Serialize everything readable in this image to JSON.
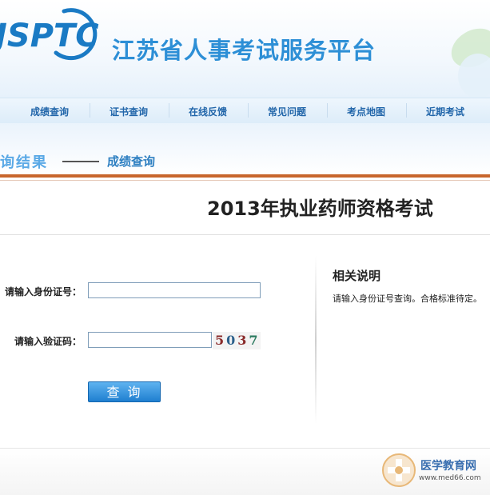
{
  "header": {
    "logo_text": "JSPTC",
    "site_title": "江苏省人事考试服务平台"
  },
  "nav": {
    "items": [
      "成绩查询",
      "证书查询",
      "在线反馈",
      "常见问题",
      "考点地图",
      "近期考试"
    ]
  },
  "breadcrumb": {
    "section": "询结果",
    "current": "成绩查询"
  },
  "exam": {
    "title": "2013年执业药师资格考试"
  },
  "form": {
    "id_label": "请输入身份证号：",
    "id_value": "",
    "captcha_label": "请输入验证码：",
    "captcha_value": "",
    "captcha_digits": [
      "5",
      "0",
      "3",
      "7"
    ],
    "submit_label": "查询"
  },
  "side": {
    "title": "相关说明",
    "text": "请输入身份证号查询。合格标准待定。"
  },
  "watermark": {
    "name": "医学教育网",
    "url": "www.med66.com"
  },
  "colors": {
    "brand_blue": "#1a7ac4",
    "accent_orange": "#c8662d",
    "button_blue": "#1f7fd0"
  }
}
